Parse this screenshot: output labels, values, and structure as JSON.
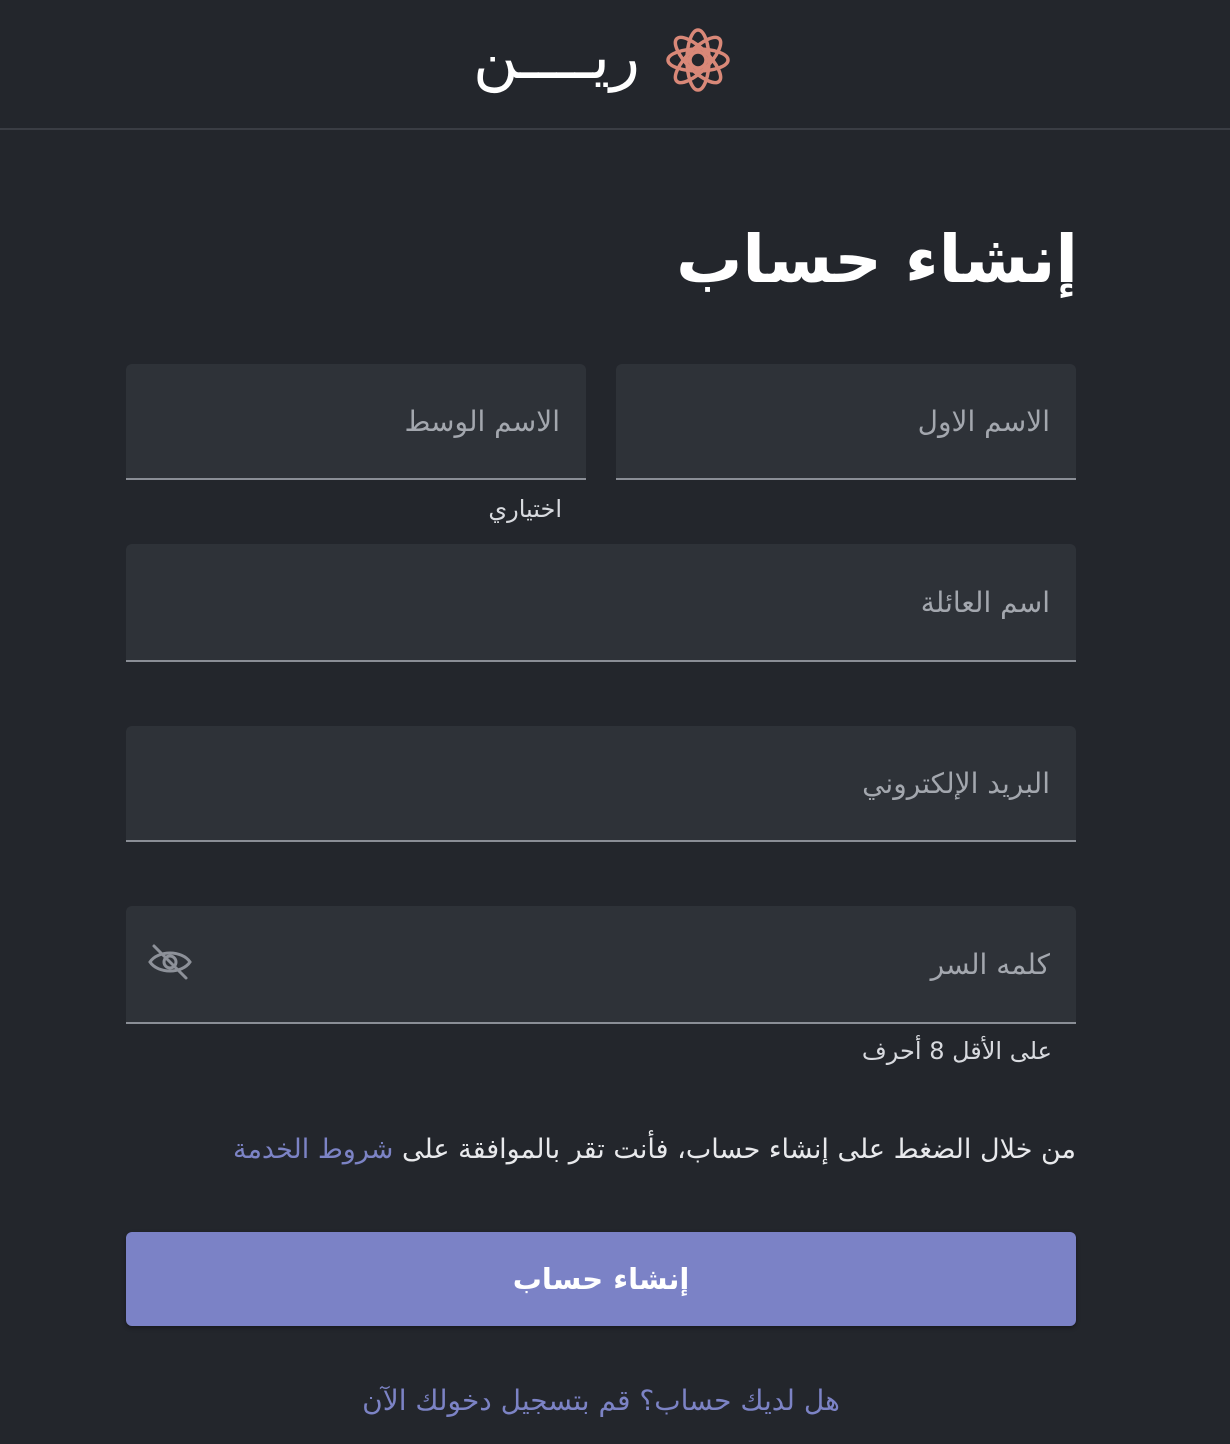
{
  "header": {
    "brand_name": "ريــــن",
    "logo_icon": "flower-logo-icon",
    "logo_color": "#d98878"
  },
  "form": {
    "title": "إنشاء حساب",
    "first_name": {
      "placeholder": "الاسم الاول",
      "value": ""
    },
    "middle_name": {
      "placeholder": "الاسم الوسط",
      "value": "",
      "helper": "اختياري"
    },
    "last_name": {
      "placeholder": "اسم العائلة",
      "value": ""
    },
    "email": {
      "placeholder": "البريد الإلكتروني",
      "value": ""
    },
    "password": {
      "placeholder": "كلمه السر",
      "value": "",
      "helper": "على الأقل 8 أحرف",
      "toggle_icon": "eye-off-icon"
    },
    "terms": {
      "text": "من خلال الضغط على إنشاء حساب، فأنت تقر بالموافقة على ",
      "link": "شروط الخدمة"
    },
    "submit_label": "إنشاء حساب",
    "login_prompt": "هل لديك حساب؟ قم بتسجيل دخولك الآن"
  },
  "colors": {
    "background": "#23262c",
    "field_background": "#2e3238",
    "accent": "#7b82c6",
    "link": "#7c83c5"
  }
}
